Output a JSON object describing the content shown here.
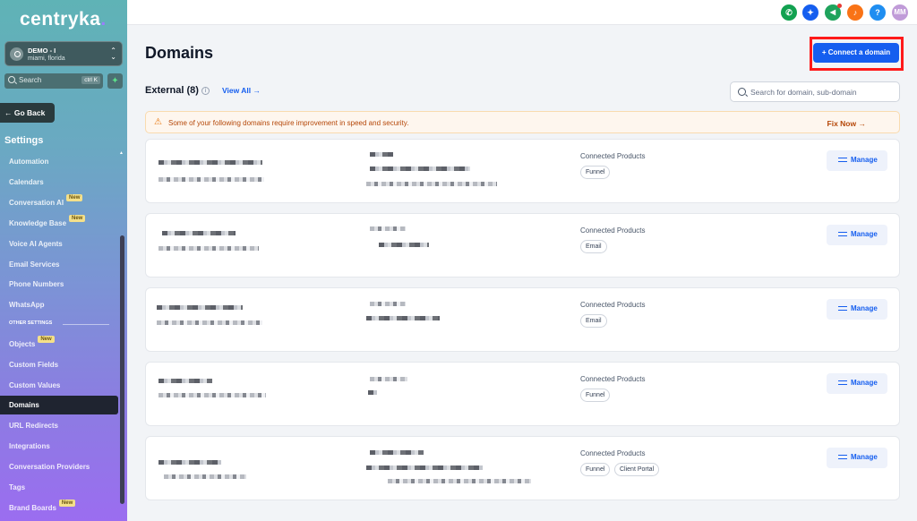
{
  "sidebar": {
    "logo": "centryka",
    "account": {
      "name": "DEMO - I",
      "location": "miami, florida"
    },
    "search": {
      "placeholder": "Search",
      "shortcut": "ctrl K"
    },
    "go_back": "Go Back",
    "section_title": "Settings",
    "items": [
      {
        "label": "Automation",
        "badge": ""
      },
      {
        "label": "Calendars",
        "badge": ""
      },
      {
        "label": "Conversation AI",
        "badge": "New"
      },
      {
        "label": "Knowledge Base",
        "badge": "New"
      },
      {
        "label": "Voice AI Agents",
        "badge": ""
      },
      {
        "label": "Email Services",
        "badge": ""
      },
      {
        "label": "Phone Numbers",
        "badge": ""
      },
      {
        "label": "WhatsApp",
        "badge": ""
      }
    ],
    "other_label": "OTHER SETTINGS",
    "other_items": [
      {
        "label": "Objects",
        "badge": "New"
      },
      {
        "label": "Custom Fields",
        "badge": ""
      },
      {
        "label": "Custom Values",
        "badge": ""
      },
      {
        "label": "Domains",
        "badge": "",
        "active": true
      },
      {
        "label": "URL Redirects",
        "badge": ""
      },
      {
        "label": "Integrations",
        "badge": ""
      },
      {
        "label": "Conversation Providers",
        "badge": ""
      },
      {
        "label": "Tags",
        "badge": ""
      },
      {
        "label": "Brand Boards",
        "badge": "New"
      }
    ]
  },
  "topbar": {
    "icons": [
      {
        "name": "phone-icon",
        "glyph": "✆",
        "color": "#12a150"
      },
      {
        "name": "magic-icon",
        "glyph": "✦",
        "color": "#155eef"
      },
      {
        "name": "megaphone-icon",
        "glyph": "📢",
        "color": "#1fa35c"
      },
      {
        "name": "bell-icon",
        "glyph": "🔔",
        "color": "#f97316"
      },
      {
        "name": "help-icon",
        "glyph": "?",
        "color": "#1f8ef1"
      }
    ],
    "avatar_initials": "MM",
    "avatar_color": "#c09bd8"
  },
  "main": {
    "title": "Domains",
    "connect_button": "+ Connect a domain",
    "external_label": "External (8)",
    "view_all": "View All",
    "search_placeholder": "Search for domain, sub-domain",
    "warning": {
      "message": "Some of your following domains require improvement in speed and security.",
      "action": "Fix Now"
    },
    "connected_label": "Connected Products",
    "manage_label": "Manage",
    "domains": [
      {
        "products": [
          "Funnel"
        ]
      },
      {
        "products": [
          "Email"
        ]
      },
      {
        "products": [
          "Email"
        ]
      },
      {
        "products": [
          "Funnel"
        ]
      },
      {
        "products": [
          "Funnel",
          "Client Portal"
        ]
      }
    ]
  },
  "colors": {
    "accent": "#155eef",
    "highlight": "#ff1a1a",
    "warning_text": "#b54708"
  }
}
